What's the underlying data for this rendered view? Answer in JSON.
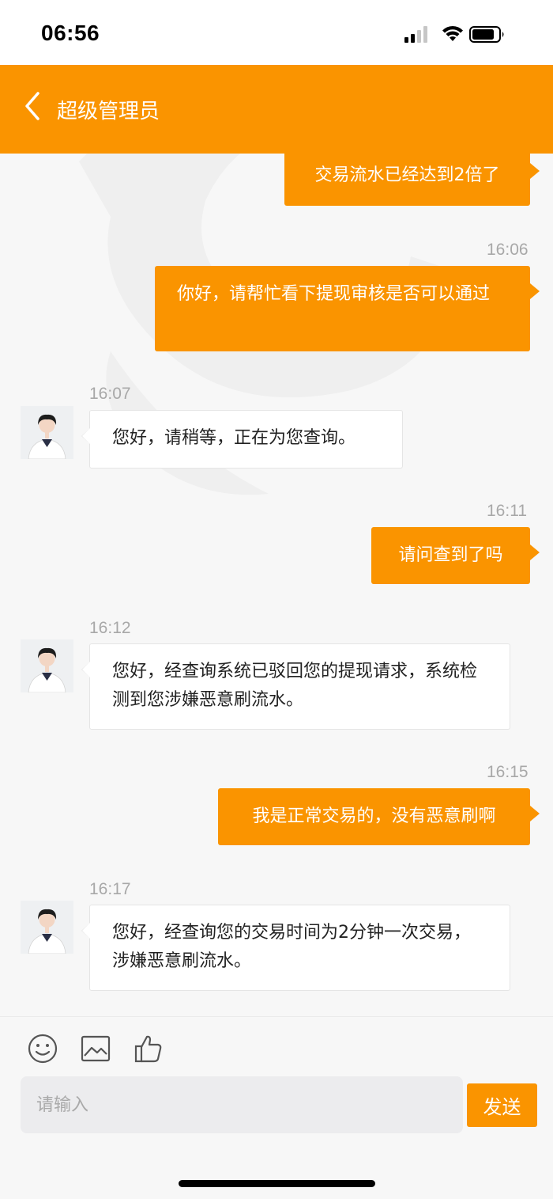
{
  "status_bar": {
    "time": "06:56",
    "icons": [
      "cellular-signal-icon",
      "wifi-icon",
      "battery-icon"
    ]
  },
  "header": {
    "back_icon": "chevron-left-icon",
    "title": "超级管理员",
    "background_color": "#fa9400"
  },
  "messages": [
    {
      "direction": "out",
      "timestamp": "",
      "text": "交易流水已经达到2倍了"
    },
    {
      "direction": "out",
      "timestamp": "16:06",
      "text": "你好，请帮忙看下提现审核是否可以通过"
    },
    {
      "direction": "in",
      "timestamp": "16:07",
      "text": "您好，请稍等，正在为您查询。"
    },
    {
      "direction": "out",
      "timestamp": "16:11",
      "text": "请问查到了吗"
    },
    {
      "direction": "in",
      "timestamp": "16:12",
      "text": "您好，经查询系统已驳回您的提现请求，系统检测到您涉嫌恶意刷流水。"
    },
    {
      "direction": "out",
      "timestamp": "16:15",
      "text": "我是正常交易的，没有恶意刷啊"
    },
    {
      "direction": "in",
      "timestamp": "16:17",
      "text": "您好，经查询您的交易时间为2分钟一次交易，涉嫌恶意刷流水。"
    }
  ],
  "toolbar": {
    "icons": [
      "emoji-icon",
      "image-icon",
      "thumbs-up-icon"
    ]
  },
  "input": {
    "value": "",
    "placeholder": "请输入"
  },
  "send_button": {
    "label": "发送"
  },
  "colors": {
    "accent": "#fa9400",
    "chat_background": "#f7f7f7",
    "incoming_bubble": "#ffffff",
    "timestamp": "#a8a8a8"
  }
}
